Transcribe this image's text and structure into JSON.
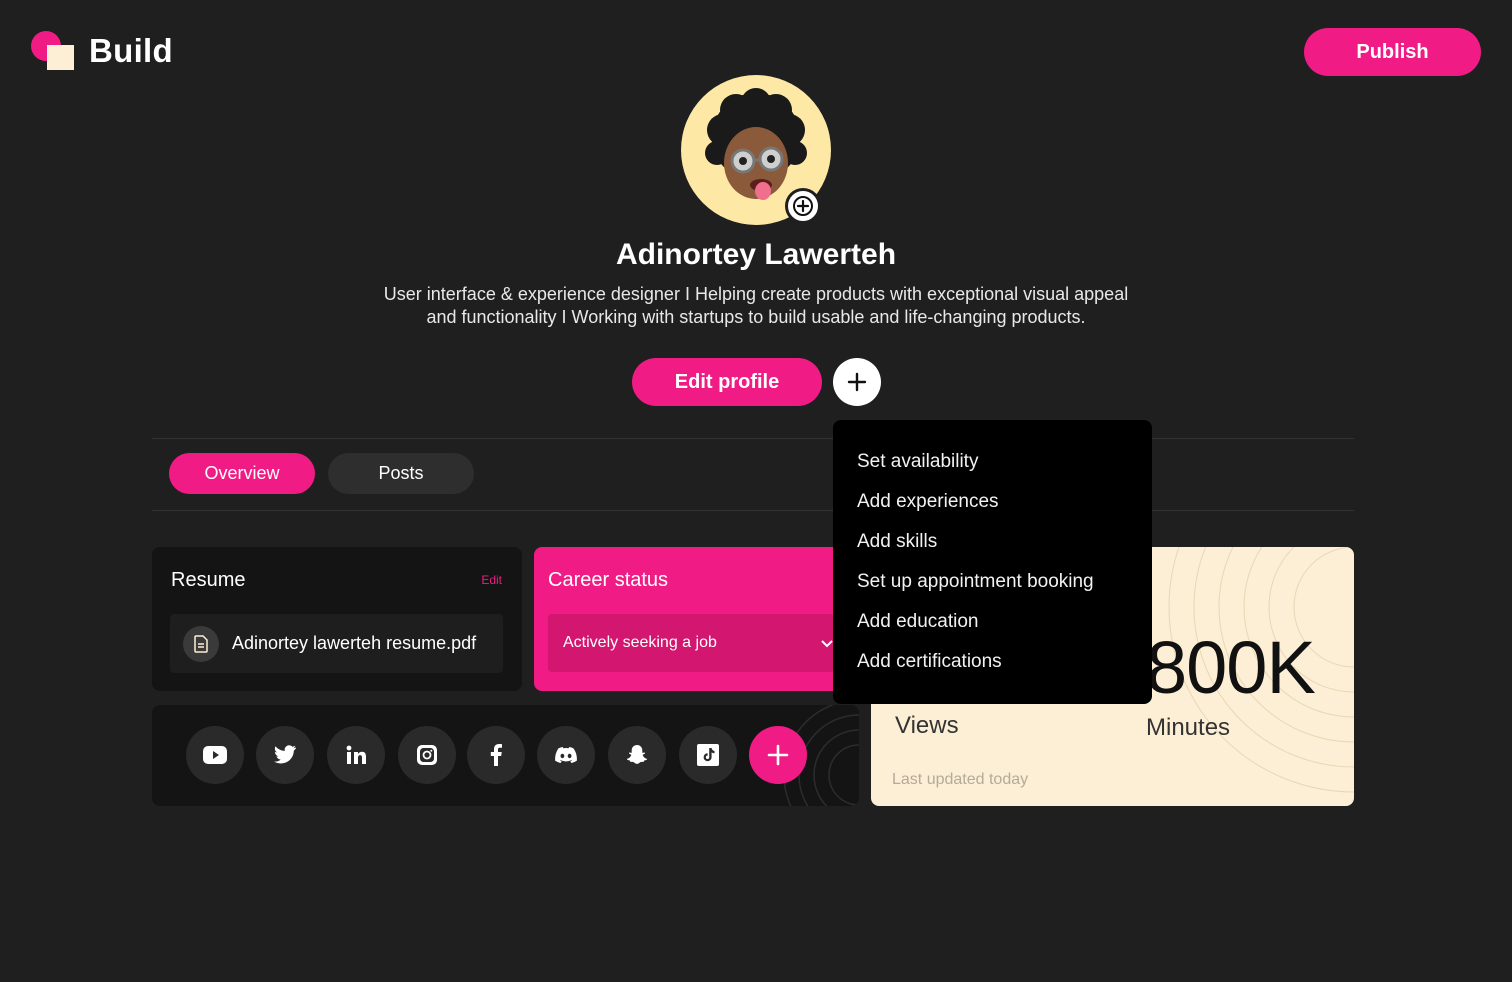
{
  "app": {
    "name": "Build"
  },
  "header": {
    "publish_label": "Publish"
  },
  "profile": {
    "name": "Adinortey Lawerteh",
    "bio_line1": "User interface & experience designer I Helping create products with exceptional visual appeal",
    "bio_line2": "and functionality I Working with startups to build usable and life-changing products.",
    "edit_label": "Edit profile"
  },
  "tabs": [
    {
      "label": "Overview",
      "active": true
    },
    {
      "label": "Posts",
      "active": false
    }
  ],
  "resume": {
    "title": "Resume",
    "edit_label": "Edit",
    "file_name": "Adinortey lawerteh resume.pdf"
  },
  "career": {
    "title": "Career status",
    "selected": "Actively seeking a job"
  },
  "stats": {
    "value": "800K",
    "views_label": "Views",
    "minutes_label": "Minutes",
    "updated": "Last updated today"
  },
  "social": {
    "icons": [
      "youtube-icon",
      "twitter-icon",
      "linkedin-icon",
      "instagram-icon",
      "facebook-icon",
      "discord-icon",
      "snapchat-icon",
      "tiktok-icon",
      "add-icon"
    ]
  },
  "add_menu": {
    "items": [
      "Set availability",
      "Add experiences",
      "Add skills",
      "Set up appointment booking",
      "Add education",
      "Add certifications"
    ]
  },
  "colors": {
    "accent": "#f01b84",
    "background": "#1f1f1f",
    "card": "#141414",
    "cream": "#fdefd5"
  }
}
